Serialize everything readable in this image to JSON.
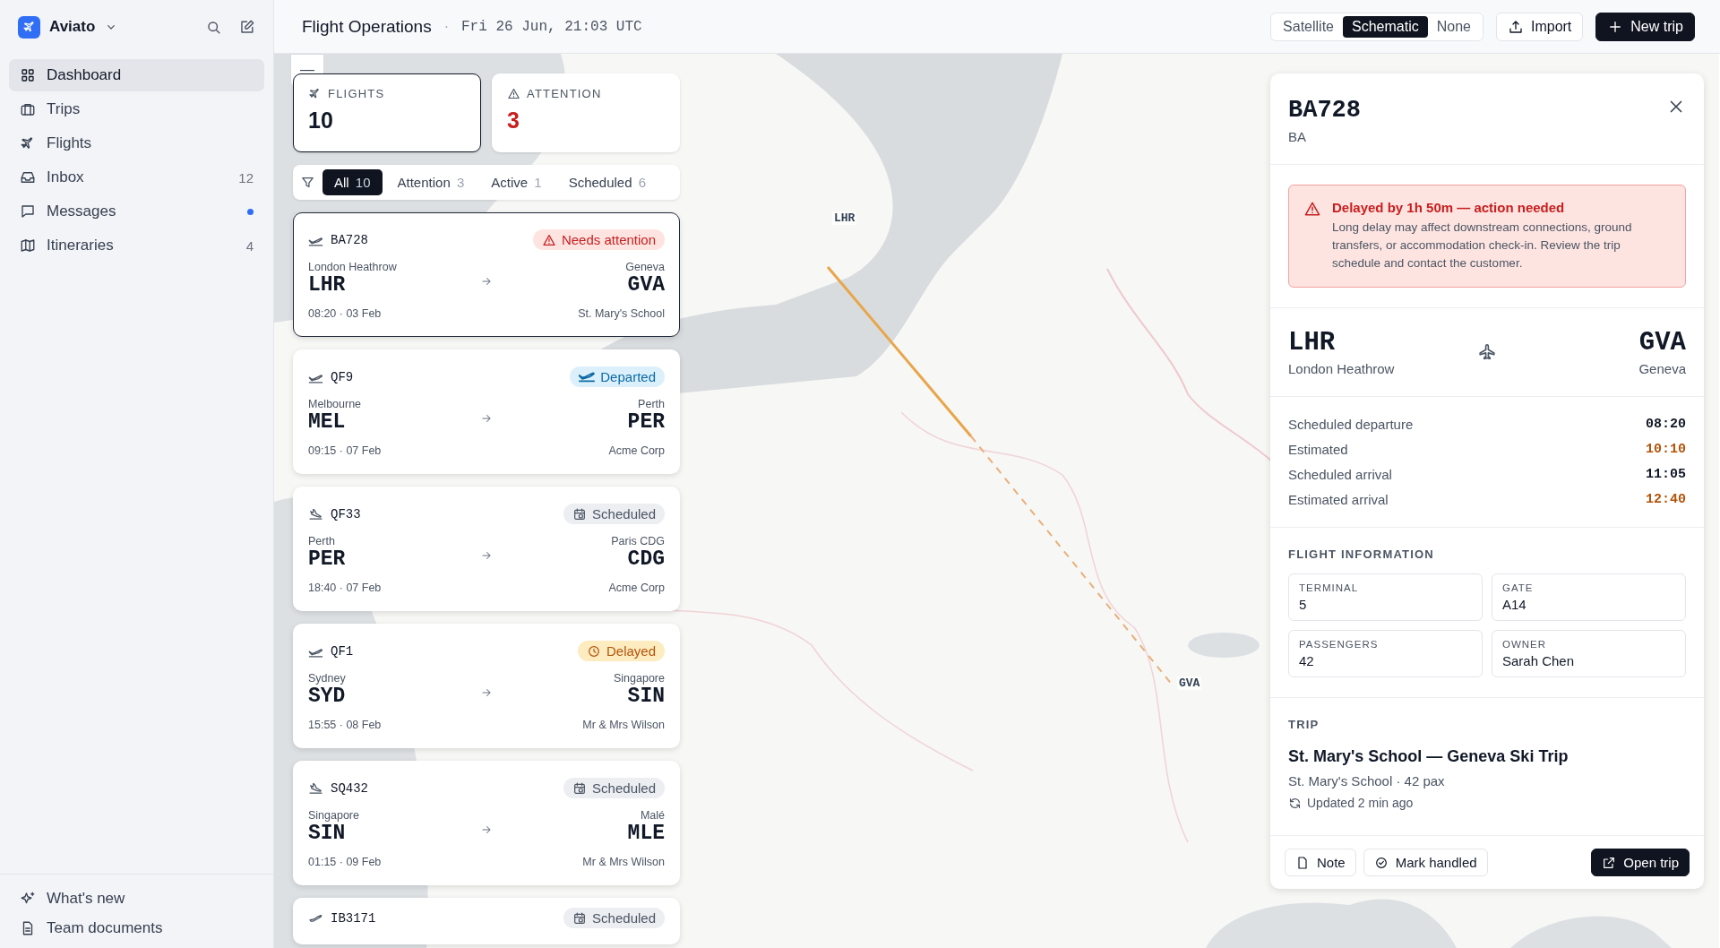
{
  "app": {
    "name": "Aviato"
  },
  "sidebar": {
    "items": [
      {
        "label": "Dashboard",
        "selected": true
      },
      {
        "label": "Trips",
        "selected": false
      },
      {
        "label": "Flights",
        "selected": false
      },
      {
        "label": "Inbox",
        "selected": false,
        "count": "12"
      },
      {
        "label": "Messages",
        "selected": false,
        "unread": true
      },
      {
        "label": "Itineraries",
        "selected": false,
        "count": "4"
      }
    ],
    "footer": [
      {
        "label": "What's new"
      },
      {
        "label": "Team documents"
      }
    ]
  },
  "header": {
    "title": "Flight Operations",
    "separator": "·",
    "time": "Fri 26 Jun, 21:03 UTC",
    "map_modes": [
      {
        "label": "Satellite",
        "selected": false
      },
      {
        "label": "Schematic",
        "selected": true
      },
      {
        "label": "None",
        "selected": false
      }
    ],
    "import": "Import",
    "new_trip": "New trip"
  },
  "map": {
    "zoom_out": "—",
    "markers": [
      {
        "code": "LHR"
      },
      {
        "code": "GVA"
      }
    ]
  },
  "stats": [
    {
      "label": "FLIGHTS",
      "value": "10",
      "kind": "flights",
      "selected": true
    },
    {
      "label": "ATTENTION",
      "value": "3",
      "kind": "attention",
      "selected": false
    }
  ],
  "filters": [
    {
      "label": "All",
      "count": "10",
      "selected": true
    },
    {
      "label": "Attention",
      "count": "3",
      "selected": false
    },
    {
      "label": "Active",
      "count": "1",
      "selected": false
    },
    {
      "label": "Scheduled",
      "count": "6",
      "selected": false
    }
  ],
  "flights": [
    {
      "number": "BA728",
      "kind": "takeoff",
      "status": {
        "label": "Needs attention",
        "kind": "attention"
      },
      "selected": true,
      "from_city": "London Heathrow",
      "from": "LHR",
      "to_city": "Geneva",
      "to": "GVA",
      "time": "08:20 · 03 Feb",
      "customer": "St. Mary's School"
    },
    {
      "number": "QF9",
      "kind": "takeoff",
      "status": {
        "label": "Departed",
        "kind": "departed"
      },
      "selected": false,
      "from_city": "Melbourne",
      "from": "MEL",
      "to_city": "Perth",
      "to": "PER",
      "time": "09:15 · 07 Feb",
      "customer": "Acme Corp"
    },
    {
      "number": "QF33",
      "kind": "landing",
      "status": {
        "label": "Scheduled",
        "kind": "scheduled"
      },
      "selected": false,
      "from_city": "Perth",
      "from": "PER",
      "to_city": "Paris CDG",
      "to": "CDG",
      "time": "18:40 · 07 Feb",
      "customer": "Acme Corp"
    },
    {
      "number": "QF1",
      "kind": "takeoff",
      "status": {
        "label": "Delayed",
        "kind": "delayed"
      },
      "selected": false,
      "from_city": "Sydney",
      "from": "SYD",
      "to_city": "Singapore",
      "to": "SIN",
      "time": "15:55 · 08 Feb",
      "customer": "Mr & Mrs Wilson"
    },
    {
      "number": "SQ432",
      "kind": "landing",
      "status": {
        "label": "Scheduled",
        "kind": "scheduled"
      },
      "selected": false,
      "from_city": "Singapore",
      "from": "SIN",
      "to_city": "Malé",
      "to": "MLE",
      "time": "01:15 · 09 Feb",
      "customer": "Mr & Mrs Wilson"
    },
    {
      "number": "IB3171",
      "kind": "plane",
      "status": {
        "label": "Scheduled",
        "kind": "scheduled"
      },
      "selected": false
    }
  ],
  "detail": {
    "flight": "BA728",
    "airline": "BA",
    "alert": {
      "title": "Delayed by 1h 50m — action needed",
      "text": "Long delay may affect downstream connections, ground transfers, or accommodation check-in. Review the trip schedule and contact the customer."
    },
    "from": "LHR",
    "from_city": "London Heathrow",
    "to": "GVA",
    "to_city": "Geneva",
    "times": [
      {
        "label": "Scheduled departure",
        "value": "08:20",
        "late": false
      },
      {
        "label": "Estimated",
        "value": "10:10",
        "late": true
      },
      {
        "label": "Scheduled arrival",
        "value": "11:05",
        "late": false
      },
      {
        "label": "Estimated arrival",
        "value": "12:40",
        "late": true
      }
    ],
    "info_title": "FLIGHT INFORMATION",
    "info": [
      {
        "label": "TERMINAL",
        "value": "5"
      },
      {
        "label": "GATE",
        "value": "A14"
      },
      {
        "label": "PASSENGERS",
        "value": "42"
      },
      {
        "label": "OWNER",
        "value": "Sarah Chen"
      }
    ],
    "trip_title": "TRIP",
    "trip_name": "St. Mary's School — Geneva Ski Trip",
    "trip_meta": "St. Mary's School · 42 pax",
    "updated": "Updated 2 min ago",
    "actions": {
      "note": "Note",
      "handled": "Mark handled",
      "open": "Open trip"
    }
  }
}
